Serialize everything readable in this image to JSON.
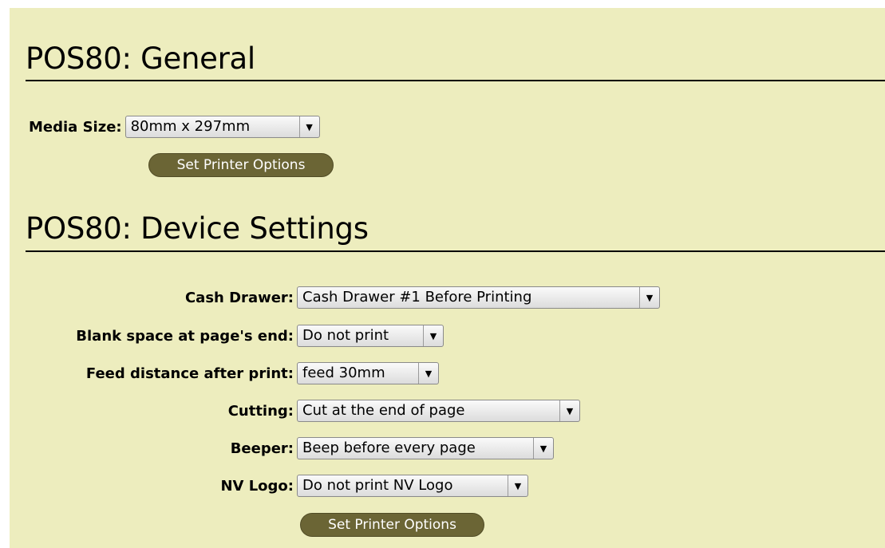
{
  "general": {
    "title": "POS80: General",
    "media_size": {
      "label": "Media Size:",
      "value": "80mm x 297mm"
    },
    "set_button": "Set Printer Options"
  },
  "device_settings": {
    "title": "POS80: Device Settings",
    "fields": [
      {
        "label": "Cash Drawer:",
        "value": "Cash Drawer #1 Before Printing"
      },
      {
        "label": "Blank space at page's end:",
        "value": "Do not print"
      },
      {
        "label": "Feed distance after print:",
        "value": "feed 30mm"
      },
      {
        "label": "Cutting:",
        "value": "Cut at the end of page"
      },
      {
        "label": "Beeper:",
        "value": "Beep before every page"
      },
      {
        "label": "NV Logo:",
        "value": "Do not print NV Logo"
      }
    ],
    "set_button": "Set Printer Options"
  },
  "icons": {
    "dropdown_arrow": "▼"
  },
  "colors": {
    "panel_background": "#ededbe",
    "button_background": "#6b6535",
    "button_text": "#ffffff"
  }
}
